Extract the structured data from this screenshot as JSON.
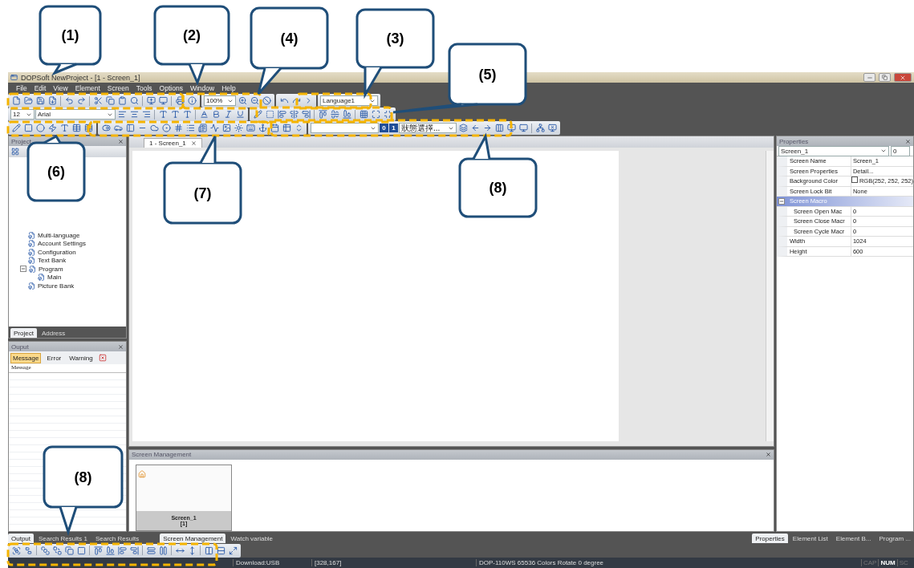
{
  "window": {
    "title": "DOPSoft NewProject - [1 - Screen_1]"
  },
  "menu": [
    "File",
    "Edit",
    "View",
    "Element",
    "Screen",
    "Tools",
    "Options",
    "Window",
    "Help"
  ],
  "toolbar": {
    "zoom": "100%",
    "language": "Language1",
    "font_size": "12",
    "font": "Arial",
    "state_0": "0",
    "state_1": "1",
    "state_select": "狀態選擇..."
  },
  "project": {
    "title": "Project",
    "tree": [
      {
        "label": "Multi-language"
      },
      {
        "label": "Account Settings"
      },
      {
        "label": "Configuration"
      },
      {
        "label": "Text Bank"
      },
      {
        "label": "Program",
        "expanded": true,
        "children": [
          {
            "label": "Main"
          }
        ]
      },
      {
        "label": "Picture Bank"
      }
    ],
    "tabs": [
      {
        "label": "Project",
        "selected": true
      },
      {
        "label": "Address",
        "selected": false
      }
    ]
  },
  "output": {
    "title": "Ouput",
    "filters": [
      {
        "label": "Message",
        "selected": true
      },
      {
        "label": "Error",
        "selected": false
      },
      {
        "label": "Warning",
        "selected": false
      }
    ],
    "column": "Message"
  },
  "document_tab": "1 - Screen_1",
  "screen_management": {
    "title": "Screen Management",
    "screens": [
      {
        "name": "Screen_1",
        "number": "[1]"
      }
    ]
  },
  "bottom_tabs": [
    {
      "label": "Output",
      "selected": true
    },
    {
      "label": "Search Results 1",
      "selected": false
    },
    {
      "label": "Search Results",
      "selected": false
    },
    {
      "label": "Screen Management",
      "selected": true
    },
    {
      "label": "Watch variable",
      "selected": false
    }
  ],
  "properties": {
    "title": "Properties",
    "object": "Screen_1",
    "spin": "0",
    "rows": [
      {
        "kind": "row",
        "name": "Screen Name",
        "value": "Screen_1"
      },
      {
        "kind": "row",
        "name": "Screen Properties",
        "value": "Detail..."
      },
      {
        "kind": "color",
        "name": "Background Color",
        "value": "RGB(252, 252, 252)"
      },
      {
        "kind": "row",
        "name": "Screen Lock Bit",
        "value": "None"
      },
      {
        "kind": "group",
        "name": "Screen Macro",
        "expanded": true
      },
      {
        "kind": "sub",
        "name": "Screen Open Mac",
        "value": "0"
      },
      {
        "kind": "sub",
        "name": "Screen Close Macr",
        "value": "0"
      },
      {
        "kind": "sub",
        "name": "Screen Cycle Macr",
        "value": "0"
      },
      {
        "kind": "row",
        "name": "Width",
        "value": "1024"
      },
      {
        "kind": "row",
        "name": "Height",
        "value": "600"
      }
    ],
    "tabs": [
      {
        "label": "Properties",
        "selected": true
      },
      {
        "label": "Element List",
        "selected": false
      },
      {
        "label": "Element B...",
        "selected": false
      },
      {
        "label": "Program ...",
        "selected": false
      }
    ]
  },
  "status": {
    "download": "Download:USB",
    "position": "[328,167]",
    "device": "DOP-110WS 65536 Colors Rotate 0 degree",
    "indicators": [
      {
        "label": "CAP",
        "on": false
      },
      {
        "label": "NUM",
        "on": true
      },
      {
        "label": "SC",
        "on": false
      }
    ]
  },
  "callouts": [
    {
      "label": "(1)"
    },
    {
      "label": "(2)"
    },
    {
      "label": "(4)"
    },
    {
      "label": "(3)"
    },
    {
      "label": "(5)"
    },
    {
      "label": "(6)"
    },
    {
      "label": "(7)"
    },
    {
      "label": "(8)"
    },
    {
      "label": "(8)"
    }
  ]
}
